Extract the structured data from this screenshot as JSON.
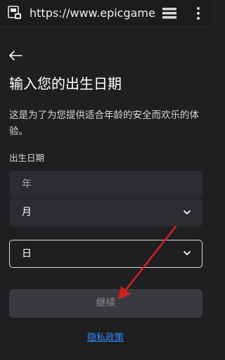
{
  "browser": {
    "url": "https://www.epicgames.c",
    "icons": [
      "site-favicon-icon",
      "tabs-icon",
      "overflow-menu-icon"
    ]
  },
  "page": {
    "back_icon": "back-arrow-icon",
    "title": "输入您的出生日期",
    "description": "这是为了为您提供适合年龄的安全而欢乐的体验。",
    "birthdate_label": "出生日期",
    "fields": {
      "year_placeholder": "年",
      "month_value": "月",
      "day_value": "日"
    },
    "continue_label": "继续",
    "privacy_link": "隐私政策"
  },
  "colors": {
    "background": "#1f1f22",
    "field_bg": "#2b2b30",
    "button_disabled_bg": "#3a3a3e",
    "link": "#2a8cff",
    "annotation_arrow": "#d22020"
  }
}
